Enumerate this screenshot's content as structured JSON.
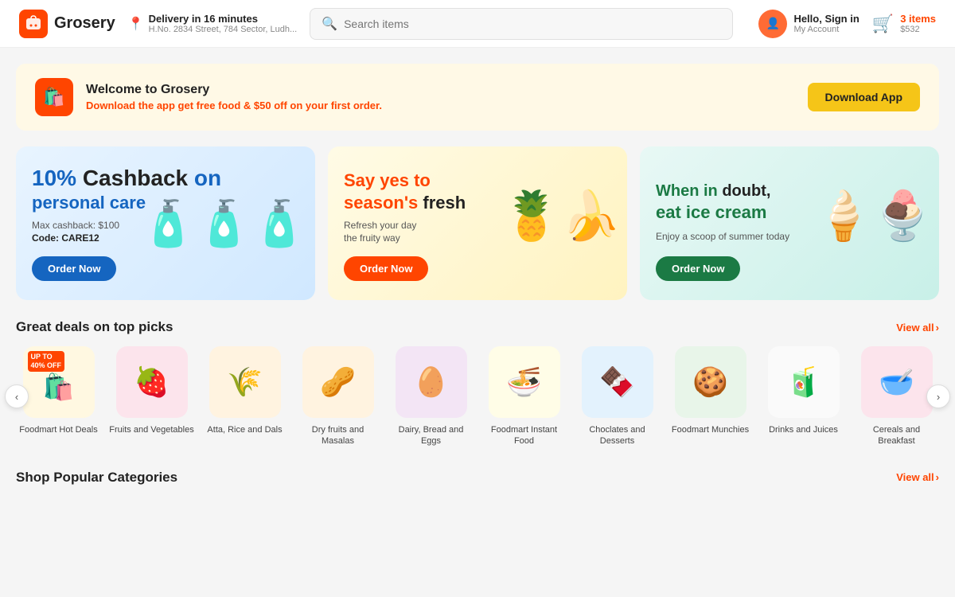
{
  "header": {
    "logo_text": "Grosery",
    "delivery_title": "Delivery in 16 minutes",
    "delivery_address": "H.No. 2834 Street, 784 Sector, Ludh...",
    "search_placeholder": "Search items",
    "account_hello": "Hello, Sign in",
    "account_sub": "My Account",
    "cart_label": "3 items",
    "cart_price": "$532"
  },
  "welcome_banner": {
    "title": "Welcome to Grosery",
    "subtitle_plain": "Download the app get free food & ",
    "subtitle_highlight": "$50",
    "subtitle_end": " off on your first order.",
    "download_btn": "Download App"
  },
  "promo_cards": [
    {
      "tag": "10%",
      "tag_type": "blue",
      "title_line1": "Cashback on",
      "title_line2": "personal care",
      "sub": "Max cashback: $100",
      "code": "Code: CARE12",
      "btn": "Order Now",
      "btn_type": "blue",
      "emoji": "🧴"
    },
    {
      "tag": "Say yes to",
      "tag_orange": "season's",
      "tag_end": " fresh",
      "desc_line1": "Refresh your day",
      "desc_line2": "the fruity way",
      "btn": "Order Now",
      "btn_type": "orange",
      "emoji": "🍍"
    },
    {
      "tag_green": "When in",
      "tag_end": " doubt,",
      "title": "eat ice cream",
      "desc": "Enjoy a scoop of summer today",
      "btn": "Order Now",
      "btn_type": "green",
      "emoji": "🍦"
    }
  ],
  "deals_section": {
    "title": "Great deals on top picks",
    "view_all": "View all"
  },
  "categories": [
    {
      "label": "Foodmart Hot Deals",
      "emoji": "🛍️",
      "bg": "hot-deals",
      "badge": "UP TO\n40% OFF"
    },
    {
      "label": "Fruits and Vegetables",
      "emoji": "🍓",
      "bg": "light-green"
    },
    {
      "label": "Atta, Rice and Dals",
      "emoji": "🌾",
      "bg": "peach"
    },
    {
      "label": "Dry fruits and Masalas",
      "emoji": "🥜",
      "bg": "peach"
    },
    {
      "label": "Dairy, Bread and Eggs",
      "emoji": "🥚",
      "bg": "lavender"
    },
    {
      "label": "Foodmart Instant Food",
      "emoji": "🍜",
      "bg": "light-yellow"
    },
    {
      "label": "Choclates and Desserts",
      "emoji": "🍫",
      "bg": "light-blue"
    },
    {
      "label": "Foodmart Munchies",
      "emoji": "🍪",
      "bg": "light-green"
    },
    {
      "label": "Drinks and Juices",
      "emoji": "🧃",
      "bg": "cream"
    },
    {
      "label": "Cereals and Breakfast",
      "emoji": "🥣",
      "bg": "pink"
    }
  ],
  "popular_section": {
    "title": "Shop Popular Categories",
    "view_all": "View all"
  }
}
